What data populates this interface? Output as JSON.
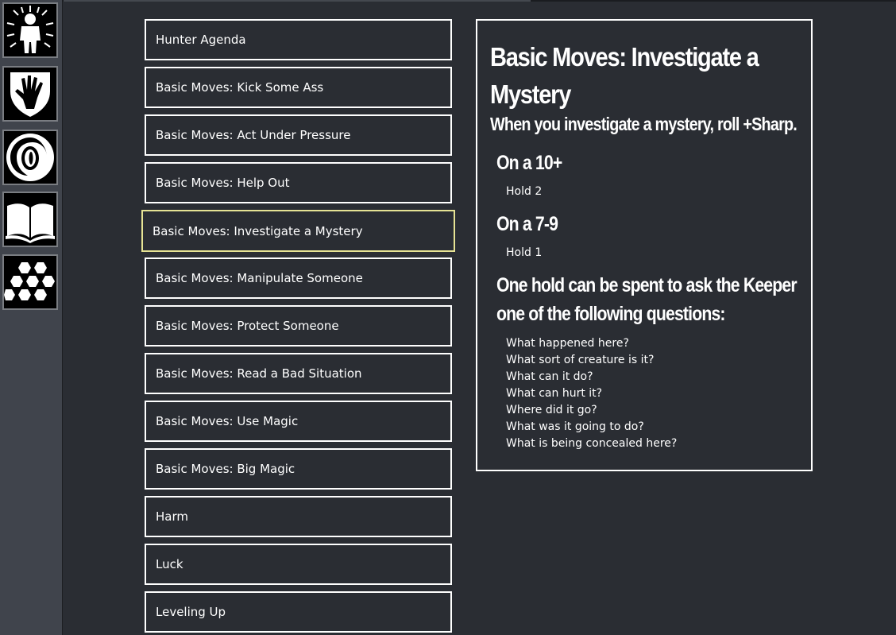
{
  "sidebar": {
    "items": [
      {
        "icon": "hunter-figure-icon"
      },
      {
        "icon": "hand-shield-icon"
      },
      {
        "icon": "eye-swirl-icon"
      },
      {
        "icon": "open-book-icon"
      },
      {
        "icon": "hexagons-icon"
      }
    ]
  },
  "menu": {
    "selected": "Basic Moves: Investigate a Mystery",
    "items": [
      "Hunter Agenda",
      "Basic Moves: Kick Some Ass",
      "Basic Moves: Act Under Pressure",
      "Basic Moves: Help Out",
      "Basic Moves: Investigate a Mystery",
      "Basic Moves: Manipulate Someone",
      "Basic Moves: Protect Someone",
      "Basic Moves: Read a Bad Situation",
      "Basic Moves: Use Magic",
      "Basic Moves: Big Magic",
      "Harm",
      "Luck",
      "Leveling Up"
    ]
  },
  "detail": {
    "title": "Basic Moves: Investigate a Mystery",
    "subtitle": "When you investigate a mystery, roll +Sharp.",
    "sections": [
      {
        "heading": "On a 10+",
        "text": "Hold 2"
      },
      {
        "heading": "On a 7-9",
        "text": "Hold 1"
      }
    ],
    "questions_heading": "One hold can be spent to ask the Keeper one of the following questions:",
    "questions": [
      "What happened here?",
      "What sort of creature is it?",
      "What can it do?",
      "What can hurt it?",
      "Where did it go?",
      "What was it going to do?",
      "What is being concealed here?"
    ]
  },
  "colors": {
    "background": "#2a2d33",
    "sidebar": "#40444c",
    "selected_border": "#e6e394",
    "border": "#ffffff"
  }
}
